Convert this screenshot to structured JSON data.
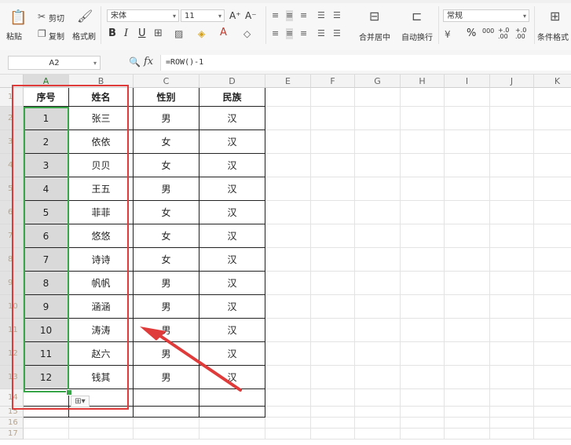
{
  "ribbon": {
    "paste": "粘贴",
    "cut": "剪切",
    "copy": "复制",
    "format_painter": "格式刷",
    "font_name": "宋体",
    "font_size": "11",
    "bold": "B",
    "italic": "I",
    "underline": "U",
    "merge_center": "合并居中",
    "wrap_text": "自动换行",
    "number_format": "常规",
    "percent": "%",
    "thousands": "000",
    "dec_inc": "+.0 .00",
    "dec_dec": "+.0 .00",
    "conditional_format": "条件格式",
    "grow_font": "A⁺",
    "shrink_font": "A⁻"
  },
  "formula_bar": {
    "name_box": "A2",
    "fx": "fx",
    "formula": "=ROW()-1"
  },
  "columns": [
    "A",
    "B",
    "C",
    "D",
    "E",
    "F",
    "G",
    "H",
    "I",
    "J",
    "K"
  ],
  "table": {
    "headers": [
      "序号",
      "姓名",
      "性别",
      "民族"
    ],
    "rows": [
      [
        "1",
        "张三",
        "男",
        "汉"
      ],
      [
        "2",
        "依依",
        "女",
        "汉"
      ],
      [
        "3",
        "贝贝",
        "女",
        "汉"
      ],
      [
        "4",
        "王五",
        "男",
        "汉"
      ],
      [
        "5",
        "菲菲",
        "女",
        "汉"
      ],
      [
        "6",
        "悠悠",
        "女",
        "汉"
      ],
      [
        "7",
        "诗诗",
        "女",
        "汉"
      ],
      [
        "8",
        "帆帆",
        "男",
        "汉"
      ],
      [
        "9",
        "涵涵",
        "男",
        "汉"
      ],
      [
        "10",
        "涛涛",
        "男",
        "汉"
      ],
      [
        "11",
        "赵六",
        "男",
        "汉"
      ],
      [
        "12",
        "钱其",
        "男",
        "汉"
      ]
    ]
  },
  "row_numbers": [
    "1",
    "2",
    "3",
    "4",
    "5",
    "6",
    "7",
    "8",
    "9",
    "10",
    "11",
    "12",
    "13",
    "14",
    "15",
    "16",
    "17"
  ],
  "colors": {
    "annotation_red": "#e03b3b",
    "selection_green": "#3aa64a"
  }
}
